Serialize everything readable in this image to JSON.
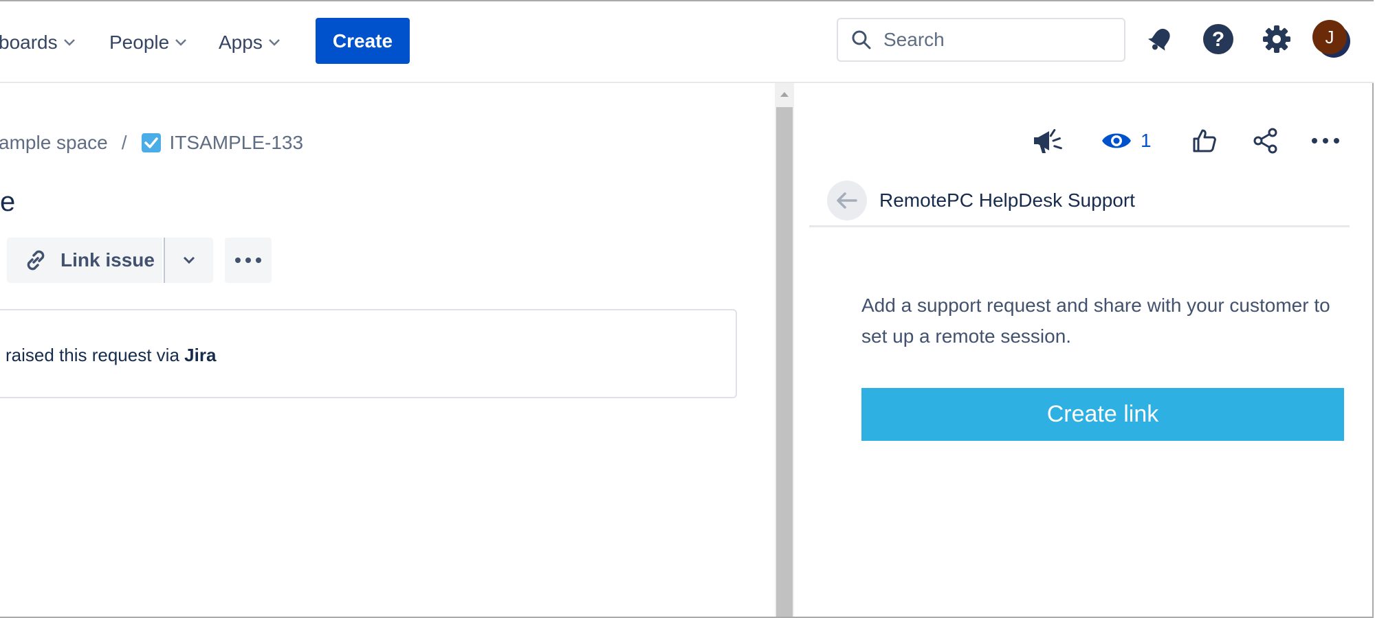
{
  "nav": {
    "dashboards_label": "boards",
    "people_label": "People",
    "apps_label": "Apps",
    "create_label": "Create",
    "search_placeholder": "Search",
    "avatar_initial": "J"
  },
  "breadcrumb": {
    "space_label": "ample space",
    "separator": "/",
    "issue_key": "ITSAMPLE-133"
  },
  "issue": {
    "title_fragment": "e",
    "link_issue_label": "Link issue",
    "request_prefix": "raised this request via ",
    "request_channel": "Jira"
  },
  "right_panel": {
    "watch_count": "1",
    "title": "RemotePC HelpDesk Support",
    "description": "Add a support request and share with your customer to set up a remote session.",
    "create_link_label": "Create link"
  },
  "colors": {
    "brand_blue": "#0052cc",
    "create_link_bg": "#2eb0e2",
    "text_primary": "#172b4d",
    "text_subtle": "#5e6c84"
  }
}
